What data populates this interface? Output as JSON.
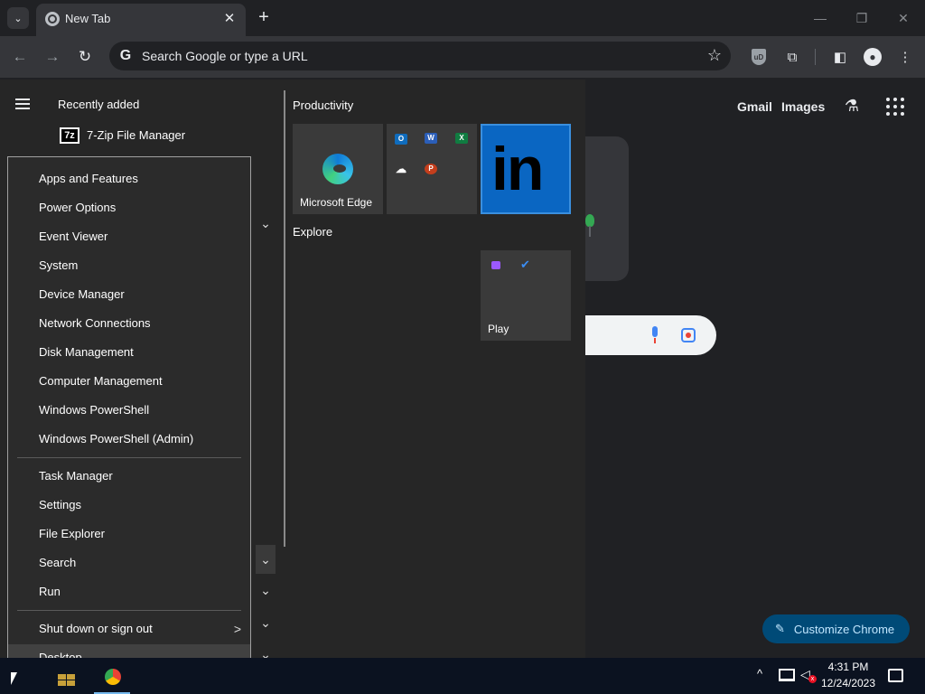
{
  "browser": {
    "tab_title": "New Tab",
    "tab_close_glyph": "✕",
    "new_tab_glyph": "+",
    "tab_search_glyph": "⌄",
    "window_minimize_glyph": "—",
    "window_restore_glyph": "❐",
    "window_close_glyph": "✕",
    "back_glyph": "←",
    "forward_glyph": "→",
    "reload_glyph": "↻",
    "omnibox_placeholder": "Search Google or type a URL",
    "google_glyph": "G",
    "star_glyph": "☆",
    "ublock_glyph": "uD",
    "extensions_glyph": "⧉",
    "sidepanel_glyph": "◧",
    "profile_glyph": "●",
    "menu_glyph": "⋮"
  },
  "ntp": {
    "gmail": "Gmail",
    "images": "Images",
    "labs_glyph": "⚗",
    "customize_label": "Customize Chrome",
    "pencil_glyph": "✎"
  },
  "start_menu": {
    "recent_header": "Recently added",
    "recent_app": "7-Zip File Manager",
    "sevenzip_glyph": "7z",
    "chevron_glyph": "⌄",
    "groups": {
      "productivity": "Productivity",
      "explore": "Explore"
    },
    "tiles": {
      "edge": "Microsoft Edge",
      "linkedin_glyph": "in",
      "play": "Play",
      "office_apps": [
        "O",
        "W",
        "X",
        "☁",
        "P"
      ]
    }
  },
  "context_menu": {
    "group1": [
      "Apps and Features",
      "Power Options",
      "Event Viewer",
      "System",
      "Device Manager",
      "Network Connections",
      "Disk Management",
      "Computer Management",
      "Windows PowerShell",
      "Windows PowerShell (Admin)"
    ],
    "group2": [
      "Task Manager",
      "Settings",
      "File Explorer",
      "Search",
      "Run"
    ],
    "shutdown": "Shut down or sign out",
    "submenu_glyph": ">",
    "desktop": "Desktop"
  },
  "taskbar": {
    "tray_up_glyph": "^",
    "volume_glyph": "◁",
    "volume_mute_glyph": "x",
    "time": "4:31 PM",
    "date": "12/24/2023"
  }
}
